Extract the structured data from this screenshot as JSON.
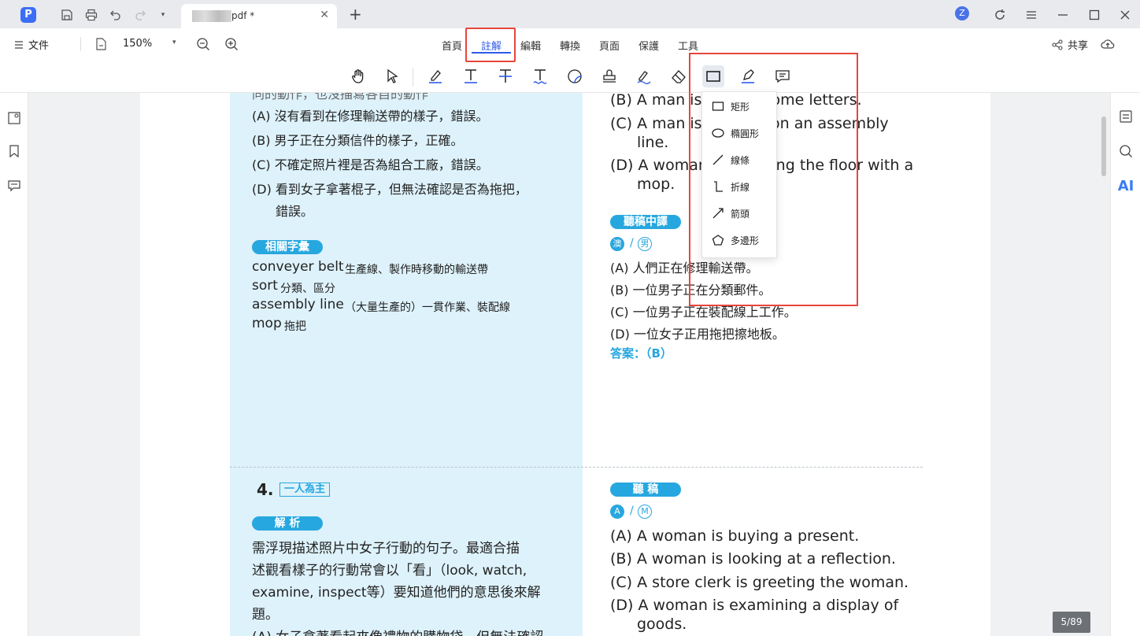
{
  "titlebar": {
    "app_logo": "P",
    "tab": {
      "title": "pdf *",
      "close": "✕"
    },
    "new_tab": "+",
    "avatar_initial": "Z"
  },
  "menubar": {
    "file": "文件",
    "zoom": "150%",
    "zoom_drop": "▾",
    "nav": [
      "首頁",
      "註解",
      "編輯",
      "轉換",
      "頁面",
      "保護",
      "工具"
    ],
    "active_nav": "註解",
    "share": "共享"
  },
  "tools": [
    "hand-icon",
    "select-arrow-icon",
    "highlight-icon",
    "underline-text-icon",
    "strikethrough-icon",
    "squiggly-text-icon",
    "sticky-eraser-icon",
    "stamp-icon",
    "signature-icon",
    "eraser-icon",
    "rectangle-shape-icon",
    "pen-icon",
    "comment-icon"
  ],
  "shapes_menu": {
    "items": [
      {
        "label": "矩形",
        "icon": "rectangle-icon"
      },
      {
        "label": "橢圓形",
        "icon": "ellipse-icon"
      },
      {
        "label": "線條",
        "icon": "line-icon"
      },
      {
        "label": "折線",
        "icon": "polyline-icon"
      },
      {
        "label": "箭頭",
        "icon": "arrow-icon"
      },
      {
        "label": "多邊形",
        "icon": "polygon-icon"
      }
    ]
  },
  "right_rail": {
    "ai": "AI"
  },
  "document": {
    "left_top": {
      "clipped_line": "同的動作，也沒描寫各自的動作",
      "options": [
        "(A) 沒有看到在修理輸送帶的樣子，錯誤。",
        "(B) 男子正在分類信件的樣子，正確。",
        "(C) 不確定照片裡是否為組合工廠，錯誤。",
        "(D) 看到女子拿著棍子，但無法確認是否為拖把，",
        "錯誤。"
      ],
      "vocab_title": "相關字彙",
      "vocab": [
        {
          "word": "conveyer belt",
          "meaning": "生產線、製作時移動的輸送帶"
        },
        {
          "word": "sort",
          "meaning": "分類、區分"
        },
        {
          "word": "assembly line",
          "meaning": "（大量生產的）一貫作業、裝配線"
        },
        {
          "word": "mop",
          "meaning": "拖把"
        }
      ]
    },
    "right_top": {
      "options": [
        "(B) A man is sorting some letters.",
        "(C) A man is working on an assembly",
        "line.",
        "(D) A woman is mopping the floor with a",
        "mop."
      ],
      "translation_title": "聽稿中譯",
      "speaker_a": "澳",
      "speaker_b": "男",
      "slash": "/",
      "translations": [
        "(A) 人們正在修理輸送帶。",
        "(B) 一位男子正在分類郵件。",
        "(C) 一位男子正在裝配線上工作。",
        "(D) 一位女子正用拖把擦地板。"
      ],
      "answer": "答案：（B）"
    },
    "left_bottom": {
      "question_number": "4.",
      "tag": "一人為主",
      "analysis_title": "解 析",
      "analysis_lines": [
        "需浮現描述照片中女子行動的句子。最適合描",
        "述觀看樣子的行動常會以「看」（look, watch,",
        "examine, inspect等）要知道他們的意思後來解",
        "題。",
        "(A) 女子拿著看起來像禮物的購物袋，但無法確認"
      ]
    },
    "right_bottom": {
      "script_title": "聽 稿",
      "speaker_a": "A",
      "speaker_b": "M",
      "slash": "/",
      "options": [
        "(A) A woman is buying a present.",
        "(B) A woman is looking at a reflection.",
        "(C) A store clerk is greeting the woman.",
        "(D) A woman is examining a display of",
        "goods."
      ]
    }
  },
  "page_counter": "5/89",
  "colors": {
    "accent": "#2e5bea",
    "highlight_box": "#e8453c",
    "doc_blue": "#27a7df",
    "doc_bg": "#def2fb"
  }
}
